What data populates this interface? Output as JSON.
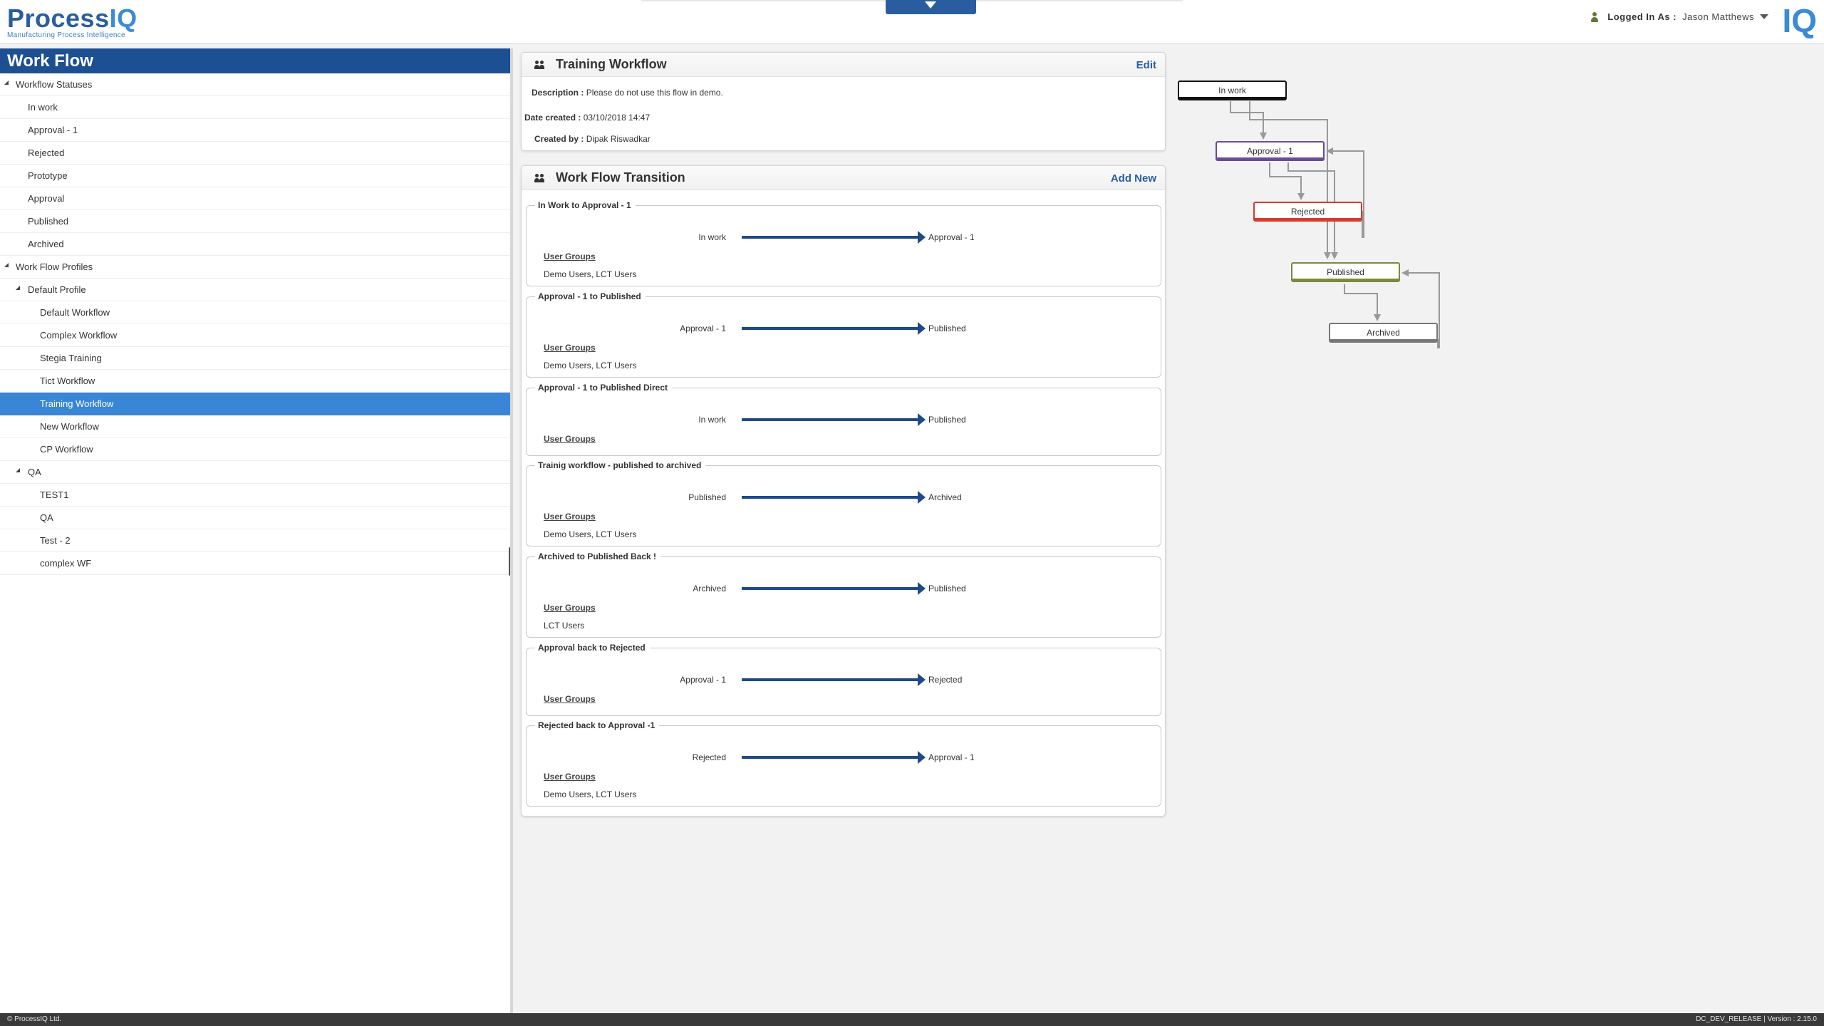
{
  "header": {
    "logo_main_a": "Process",
    "logo_main_b": "IQ",
    "logo_sub": "Manufacturing Process Intelligence",
    "logged_in_label": "Logged In As :",
    "user_name": "Jason Matthews",
    "iq_logo": "IQ"
  },
  "sidebar": {
    "title": "Work Flow",
    "items": [
      {
        "label": "Workflow Statuses",
        "level": 0,
        "toggle": true,
        "selected": false
      },
      {
        "label": "In work",
        "level": 1,
        "toggle": false,
        "selected": false
      },
      {
        "label": "Approval - 1",
        "level": 1,
        "toggle": false,
        "selected": false
      },
      {
        "label": "Rejected",
        "level": 1,
        "toggle": false,
        "selected": false
      },
      {
        "label": "Prototype",
        "level": 1,
        "toggle": false,
        "selected": false
      },
      {
        "label": "Approval",
        "level": 1,
        "toggle": false,
        "selected": false
      },
      {
        "label": "Published",
        "level": 1,
        "toggle": false,
        "selected": false
      },
      {
        "label": "Archived",
        "level": 1,
        "toggle": false,
        "selected": false
      },
      {
        "label": "Work Flow Profiles",
        "level": 0,
        "toggle": true,
        "selected": false
      },
      {
        "label": "Default Profile",
        "level": 1,
        "toggle": true,
        "selected": false
      },
      {
        "label": "Default Workflow",
        "level": 2,
        "toggle": false,
        "selected": false
      },
      {
        "label": "Complex Workflow",
        "level": 2,
        "toggle": false,
        "selected": false
      },
      {
        "label": "Stegia Training",
        "level": 2,
        "toggle": false,
        "selected": false
      },
      {
        "label": "Tict Workflow",
        "level": 2,
        "toggle": false,
        "selected": false
      },
      {
        "label": "Training Workflow",
        "level": 2,
        "toggle": false,
        "selected": true
      },
      {
        "label": "New Workflow",
        "level": 2,
        "toggle": false,
        "selected": false
      },
      {
        "label": "CP Workflow",
        "level": 2,
        "toggle": false,
        "selected": false
      },
      {
        "label": "QA",
        "level": 1,
        "toggle": true,
        "selected": false
      },
      {
        "label": "TEST1",
        "level": 2,
        "toggle": false,
        "selected": false
      },
      {
        "label": "QA",
        "level": 2,
        "toggle": false,
        "selected": false
      },
      {
        "label": "Test - 2",
        "level": 2,
        "toggle": false,
        "selected": false
      },
      {
        "label": "complex WF",
        "level": 2,
        "toggle": false,
        "selected": false
      }
    ]
  },
  "details": {
    "title": "Training Workflow",
    "edit_label": "Edit",
    "description_label": "Description :",
    "description": "Please do not use this flow in demo.",
    "date_label": "Date created :",
    "date": "03/10/2018 14:47",
    "created_by_label": "Created by :",
    "created_by": "Dipak Riswadkar"
  },
  "transitions_panel": {
    "title": "Work Flow Transition",
    "add_label": "Add New",
    "user_groups_label": "User Groups",
    "items": [
      {
        "name": "In Work to Approval - 1",
        "from": "In work",
        "to": "Approval - 1",
        "groups": "Demo Users, LCT Users"
      },
      {
        "name": "Approval - 1 to Published",
        "from": "Approval - 1",
        "to": "Published",
        "groups": "Demo Users, LCT Users"
      },
      {
        "name": "Approval - 1 to Published Direct",
        "from": "In work",
        "to": "Published",
        "groups": ""
      },
      {
        "name": "Trainig workflow - published to archived",
        "from": "Published",
        "to": "Archived",
        "groups": "Demo Users, LCT Users"
      },
      {
        "name": "Archived to Published Back !",
        "from": "Archived",
        "to": "Published",
        "groups": "LCT Users"
      },
      {
        "name": "Approval back to Rejected",
        "from": "Approval - 1",
        "to": "Rejected",
        "groups": ""
      },
      {
        "name": "Rejected back to Approval -1",
        "from": "Rejected",
        "to": "Approval - 1",
        "groups": "Demo Users, LCT Users"
      }
    ]
  },
  "diagram": {
    "nodes": [
      {
        "label": "In work",
        "color": "#111111"
      },
      {
        "label": "Approval - 1",
        "color": "#6a4a9c"
      },
      {
        "label": "Rejected",
        "color": "#d83a2e"
      },
      {
        "label": "Published",
        "color": "#7a8a3a"
      },
      {
        "label": "Archived",
        "color": "#777777"
      }
    ]
  },
  "footer": {
    "copyright": "© ProcessIQ Ltd.",
    "version": "DC_DEV_RELEASE | Version : 2.15.0"
  }
}
